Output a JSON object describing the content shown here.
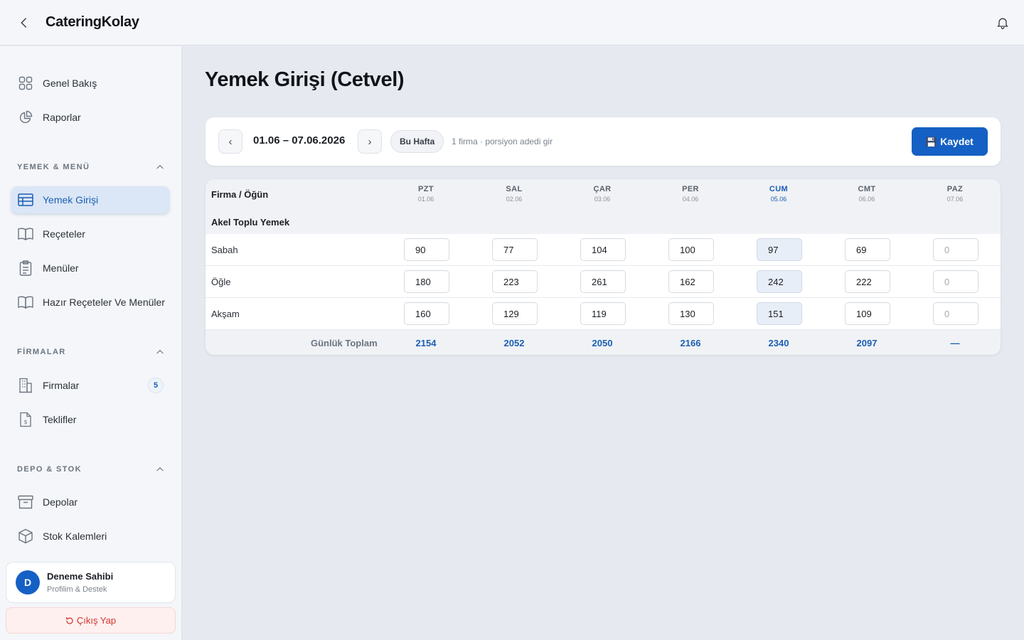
{
  "app": {
    "title": "CateringKolay"
  },
  "sidebar": {
    "top_items": [
      {
        "label": "Genel Bakış",
        "icon": "grid-icon"
      },
      {
        "label": "Raporlar",
        "icon": "pie-chart-icon"
      }
    ],
    "sections": [
      {
        "title": "YEMEK & MENÜ",
        "items": [
          {
            "label": "Yemek Girişi",
            "icon": "table-icon",
            "active": true
          },
          {
            "label": "Reçeteler",
            "icon": "book-icon"
          },
          {
            "label": "Menüler",
            "icon": "clipboard-icon"
          },
          {
            "label": "Hazır Reçeteler Ve Menüler",
            "icon": "book-icon"
          }
        ]
      },
      {
        "title": "FİRMALAR",
        "items": [
          {
            "label": "Firmalar",
            "icon": "building-icon",
            "badge": "5"
          },
          {
            "label": "Teklifler",
            "icon": "invoice-icon"
          }
        ]
      },
      {
        "title": "DEPO & STOK",
        "items": [
          {
            "label": "Depolar",
            "icon": "archive-icon"
          },
          {
            "label": "Stok Kalemleri",
            "icon": "box-icon"
          }
        ]
      }
    ],
    "profile": {
      "initial": "D",
      "name": "Deneme Sahibi",
      "subtitle": "Profilim & Destek"
    },
    "logout_label": "Çıkış Yap"
  },
  "main": {
    "page_title": "Yemek Girişi (Cetvel)",
    "toolbar": {
      "prev_label": "‹",
      "next_label": "›",
      "date_range": "01.06 – 07.06.2026",
      "this_week_label": "Bu Hafta",
      "hint": "1 firma · porsiyon adedi gir",
      "save_label": "Kaydet"
    },
    "grid": {
      "first_column_header": "Firma / Öğün",
      "days": [
        {
          "name": "PZT",
          "date": "01.06",
          "today": false
        },
        {
          "name": "SAL",
          "date": "02.06",
          "today": false
        },
        {
          "name": "ÇAR",
          "date": "03.06",
          "today": false
        },
        {
          "name": "PER",
          "date": "04.06",
          "today": false
        },
        {
          "name": "CUM",
          "date": "05.06",
          "today": true
        },
        {
          "name": "CMT",
          "date": "06.06",
          "today": false
        },
        {
          "name": "PAZ",
          "date": "07.06",
          "today": false
        }
      ],
      "company": "Akel Toplu Yemek",
      "rows": [
        {
          "meal": "Sabah",
          "values": [
            "90",
            "77",
            "104",
            "100",
            "97",
            "69",
            "0"
          ]
        },
        {
          "meal": "Öğle",
          "values": [
            "180",
            "223",
            "261",
            "162",
            "242",
            "222",
            "0"
          ]
        },
        {
          "meal": "Akşam",
          "values": [
            "160",
            "129",
            "119",
            "130",
            "151",
            "109",
            "0"
          ]
        }
      ],
      "total_label": "Günlük Toplam",
      "totals": [
        "2154",
        "2052",
        "2050",
        "2166",
        "2340",
        "2097",
        "—"
      ]
    }
  },
  "colors": {
    "accent": "#1560c4",
    "danger": "#d3342b",
    "background": "#e6eaf0"
  }
}
